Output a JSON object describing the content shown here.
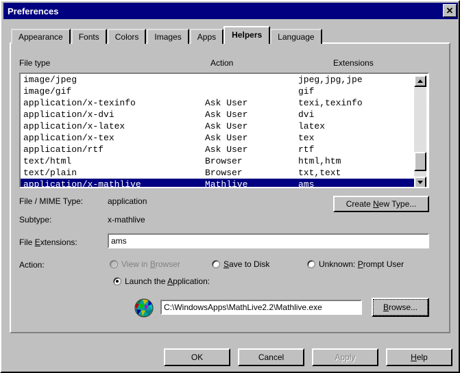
{
  "window": {
    "title": "Preferences",
    "close_label": "✕",
    "titlebar_color": "#000080"
  },
  "tabs": [
    {
      "label": "Appearance",
      "active": false
    },
    {
      "label": "Fonts",
      "active": false
    },
    {
      "label": "Colors",
      "active": false
    },
    {
      "label": "Images",
      "active": false
    },
    {
      "label": "Apps",
      "active": false
    },
    {
      "label": "Helpers",
      "active": true
    },
    {
      "label": "Language",
      "active": false
    }
  ],
  "list": {
    "headers": {
      "file_type": "File type",
      "action": "Action",
      "extensions": "Extensions"
    },
    "rows": [
      {
        "type": "image/jpeg",
        "action": "",
        "ext": "jpeg,jpg,jpe",
        "selected": false
      },
      {
        "type": "image/gif",
        "action": "",
        "ext": "gif",
        "selected": false
      },
      {
        "type": "application/x-texinfo",
        "action": "Ask User",
        "ext": "texi,texinfo",
        "selected": false
      },
      {
        "type": "application/x-dvi",
        "action": "Ask User",
        "ext": "dvi",
        "selected": false
      },
      {
        "type": "application/x-latex",
        "action": "Ask User",
        "ext": "latex",
        "selected": false
      },
      {
        "type": "application/x-tex",
        "action": "Ask User",
        "ext": "tex",
        "selected": false
      },
      {
        "type": "application/rtf",
        "action": "Ask User",
        "ext": "rtf",
        "selected": false
      },
      {
        "type": "text/html",
        "action": "Browser",
        "ext": "html,htm",
        "selected": false
      },
      {
        "type": "text/plain",
        "action": "Browser",
        "ext": "txt,text",
        "selected": false
      },
      {
        "type": "application/x-mathlive",
        "action": "Mathlive",
        "ext": "ams",
        "selected": true
      }
    ],
    "selection_color": "#000080",
    "selection_text_color": "#ffffff"
  },
  "details": {
    "mime_label": "File / MIME Type:",
    "mime_value": "application",
    "subtype_label": "Subtype:",
    "subtype_value": "x-mathlive",
    "extensions_label_pre": "File ",
    "extensions_label_acc": "E",
    "extensions_label_post": "xtensions:",
    "extensions_value": "ams",
    "create_new_type_pre": "Create ",
    "create_new_type_acc": "N",
    "create_new_type_post": "ew Type..."
  },
  "action": {
    "label": "Action:",
    "options": [
      {
        "id": "view-in-browser",
        "pre": "View in ",
        "acc": "B",
        "post": "rowser",
        "checked": false,
        "disabled": true
      },
      {
        "id": "save-to-disk",
        "pre": "",
        "acc": "S",
        "post": "ave to Disk",
        "checked": false,
        "disabled": false
      },
      {
        "id": "unknown-prompt-user",
        "pre": "Unknown: ",
        "acc": "P",
        "post": "rompt User",
        "checked": false,
        "disabled": false
      },
      {
        "id": "launch-the-application",
        "pre": "Launch the ",
        "acc": "A",
        "post": "pplication:",
        "checked": true,
        "disabled": false
      }
    ]
  },
  "application": {
    "icon": "globe-icon",
    "path_value": "C:\\WindowsApps\\MathLive2.2\\Mathlive.exe",
    "browse_pre": "",
    "browse_acc": "B",
    "browse_post": "rowse..."
  },
  "buttons": {
    "ok": "OK",
    "cancel": "Cancel",
    "apply": "Apply",
    "help_pre": "",
    "help_acc": "H",
    "help_post": "elp",
    "apply_disabled": true
  }
}
